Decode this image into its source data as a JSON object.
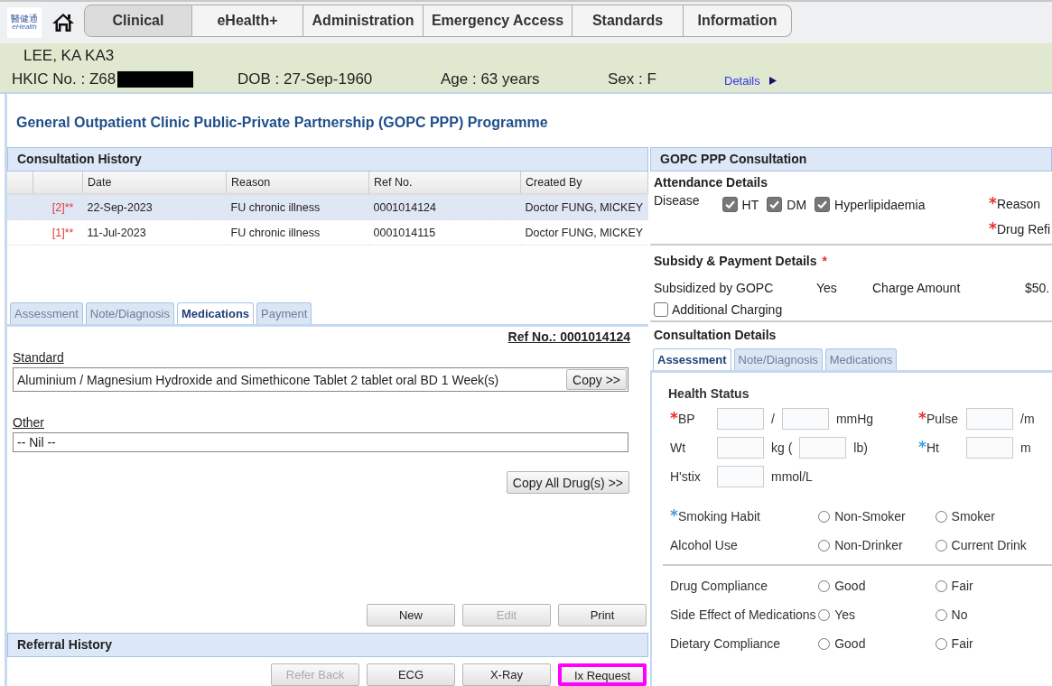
{
  "logo": {
    "text": "醫健通",
    "subtext": "eHealth"
  },
  "nav_tabs": [
    {
      "label": "Clinical",
      "selected": true
    },
    {
      "label": "eHealth+",
      "selected": false
    },
    {
      "label": "Administration",
      "selected": false
    },
    {
      "label": "Emergency Access",
      "selected": false
    },
    {
      "label": "Standards",
      "selected": false
    },
    {
      "label": "Information",
      "selected": false
    }
  ],
  "patient": {
    "name": "LEE, KA KA3",
    "hkic": "HKIC No. : Z68",
    "hkic_redacted": true,
    "dob": "DOB : 27-Sep-1960",
    "age": "Age : 63 years",
    "sex": "Sex : F",
    "details_link": "Details"
  },
  "page_title": "General Outpatient Clinic Public-Private Partnership (GOPC PPP) Programme",
  "consultation_history": {
    "title": "Consultation History",
    "columns": [
      "Date",
      "Reason",
      "Ref No.",
      "Created By"
    ],
    "rows": [
      {
        "marker": "[2]**",
        "date": "22-Sep-2023",
        "reason": "FU chronic illness",
        "ref_no": "0001014124",
        "created_by": "Doctor FUNG, MICKEY",
        "selected": true
      },
      {
        "marker": "[1]**",
        "date": "11-Jul-2023",
        "reason": "FU chronic illness",
        "ref_no": "0001014115",
        "created_by": "Doctor FUNG, MICKEY",
        "selected": false
      }
    ]
  },
  "record_tabs": [
    {
      "label": "Assessment",
      "selected": false
    },
    {
      "label": "Note/Diagnosis",
      "selected": false
    },
    {
      "label": "Medications",
      "selected": true
    },
    {
      "label": "Payment",
      "selected": false
    }
  ],
  "ref_no": "Ref No.: 0001014124",
  "standard": {
    "label": "Standard",
    "value": "Aluminium / Magnesium Hydroxide and Simethicone Tablet 2 tablet oral BD 1 Week(s)",
    "button": "Copy >>"
  },
  "other": {
    "label": "Other",
    "value": "-- Nil --"
  },
  "copy_all_button": "Copy All Drug(s) >>",
  "record_buttons": [
    {
      "label": "New",
      "disabled": false
    },
    {
      "label": "Edit",
      "disabled": true
    },
    {
      "label": "Print",
      "disabled": false
    }
  ],
  "referral_history": {
    "title": "Referral History",
    "buttons": [
      {
        "label": "Refer Back",
        "disabled": true,
        "highlighted": false
      },
      {
        "label": "ECG",
        "disabled": false,
        "highlighted": false
      },
      {
        "label": "X-Ray",
        "disabled": false,
        "highlighted": false
      },
      {
        "label": "Ix Request",
        "disabled": false,
        "highlighted": true
      }
    ]
  },
  "consultation": {
    "title": "GOPC PPP Consultation",
    "attendance": {
      "title": "Attendance Details",
      "disease_label": "Disease",
      "diseases": [
        {
          "label": "HT",
          "checked": true
        },
        {
          "label": "DM",
          "checked": true
        },
        {
          "label": "Hyperlipidaemia",
          "checked": true
        }
      ],
      "fields": [
        {
          "label": "Reason",
          "mark": "*",
          "color": "#e8302f"
        },
        {
          "label": "Drug Refi",
          "mark": "*",
          "color": "#e8302f"
        }
      ]
    },
    "subsidy": {
      "title": "Subsidy & Payment Details",
      "mark": "*",
      "subsidized_label": "Subsidized by GOPC",
      "subsidized_value": "Yes",
      "charge_label": "Charge Amount",
      "charge_value": "$50.",
      "additional_charging": {
        "label": "Additional Charging",
        "checked": false
      }
    },
    "details_title": "Consultation Details",
    "tabs": [
      {
        "label": "Assessment",
        "selected": true
      },
      {
        "label": "Note/Diagnosis",
        "selected": false
      },
      {
        "label": "Medications",
        "selected": false
      }
    ],
    "health_status_title": "Health Status",
    "vitals": [
      {
        "label": "BP",
        "mark": "*",
        "color": "#e8302f",
        "parts": [
          {
            "kind": "input"
          },
          {
            "kind": "text",
            "text": "/"
          },
          {
            "kind": "input"
          },
          {
            "kind": "text",
            "text": "mmHg"
          }
        ]
      },
      {
        "label": "Pulse",
        "mark": "*",
        "color": "#e8302f",
        "parts": [
          {
            "kind": "input"
          },
          {
            "kind": "text",
            "text": "/m"
          }
        ]
      },
      {
        "label": "Wt",
        "parts": [
          {
            "kind": "input"
          },
          {
            "kind": "text",
            "text": "kg ("
          },
          {
            "kind": "input"
          },
          {
            "kind": "text",
            "text": "lb)"
          }
        ]
      },
      {
        "label": "Ht",
        "mark": "*",
        "color": "#3aa0e0",
        "parts": [
          {
            "kind": "input"
          },
          {
            "kind": "text",
            "text": "m"
          }
        ]
      },
      {
        "label": "H'stix",
        "parts": [
          {
            "kind": "input"
          },
          {
            "kind": "text",
            "text": "mmol/L"
          }
        ]
      }
    ],
    "habits": [
      {
        "label": "Smoking Habit",
        "mark": "*",
        "color": "#3aa0e0",
        "options": [
          {
            "label": "Non-Smoker",
            "selected": false
          },
          {
            "label": "Smoker",
            "selected": false
          }
        ]
      },
      {
        "label": "Alcohol Use",
        "options": [
          {
            "label": "Non-Drinker",
            "selected": false
          },
          {
            "label": "Current Drink",
            "selected": false
          }
        ]
      }
    ],
    "compliance": [
      {
        "label": "Drug Compliance",
        "options": [
          {
            "label": "Good",
            "selected": false
          },
          {
            "label": "Fair",
            "selected": false
          }
        ]
      },
      {
        "label": "Side Effect of Medications",
        "options": [
          {
            "label": "Yes",
            "selected": false
          },
          {
            "label": "No",
            "selected": false
          }
        ]
      },
      {
        "label": "Dietary Compliance",
        "options": [
          {
            "label": "Good",
            "selected": false
          },
          {
            "label": "Fair",
            "selected": false
          }
        ]
      }
    ]
  }
}
